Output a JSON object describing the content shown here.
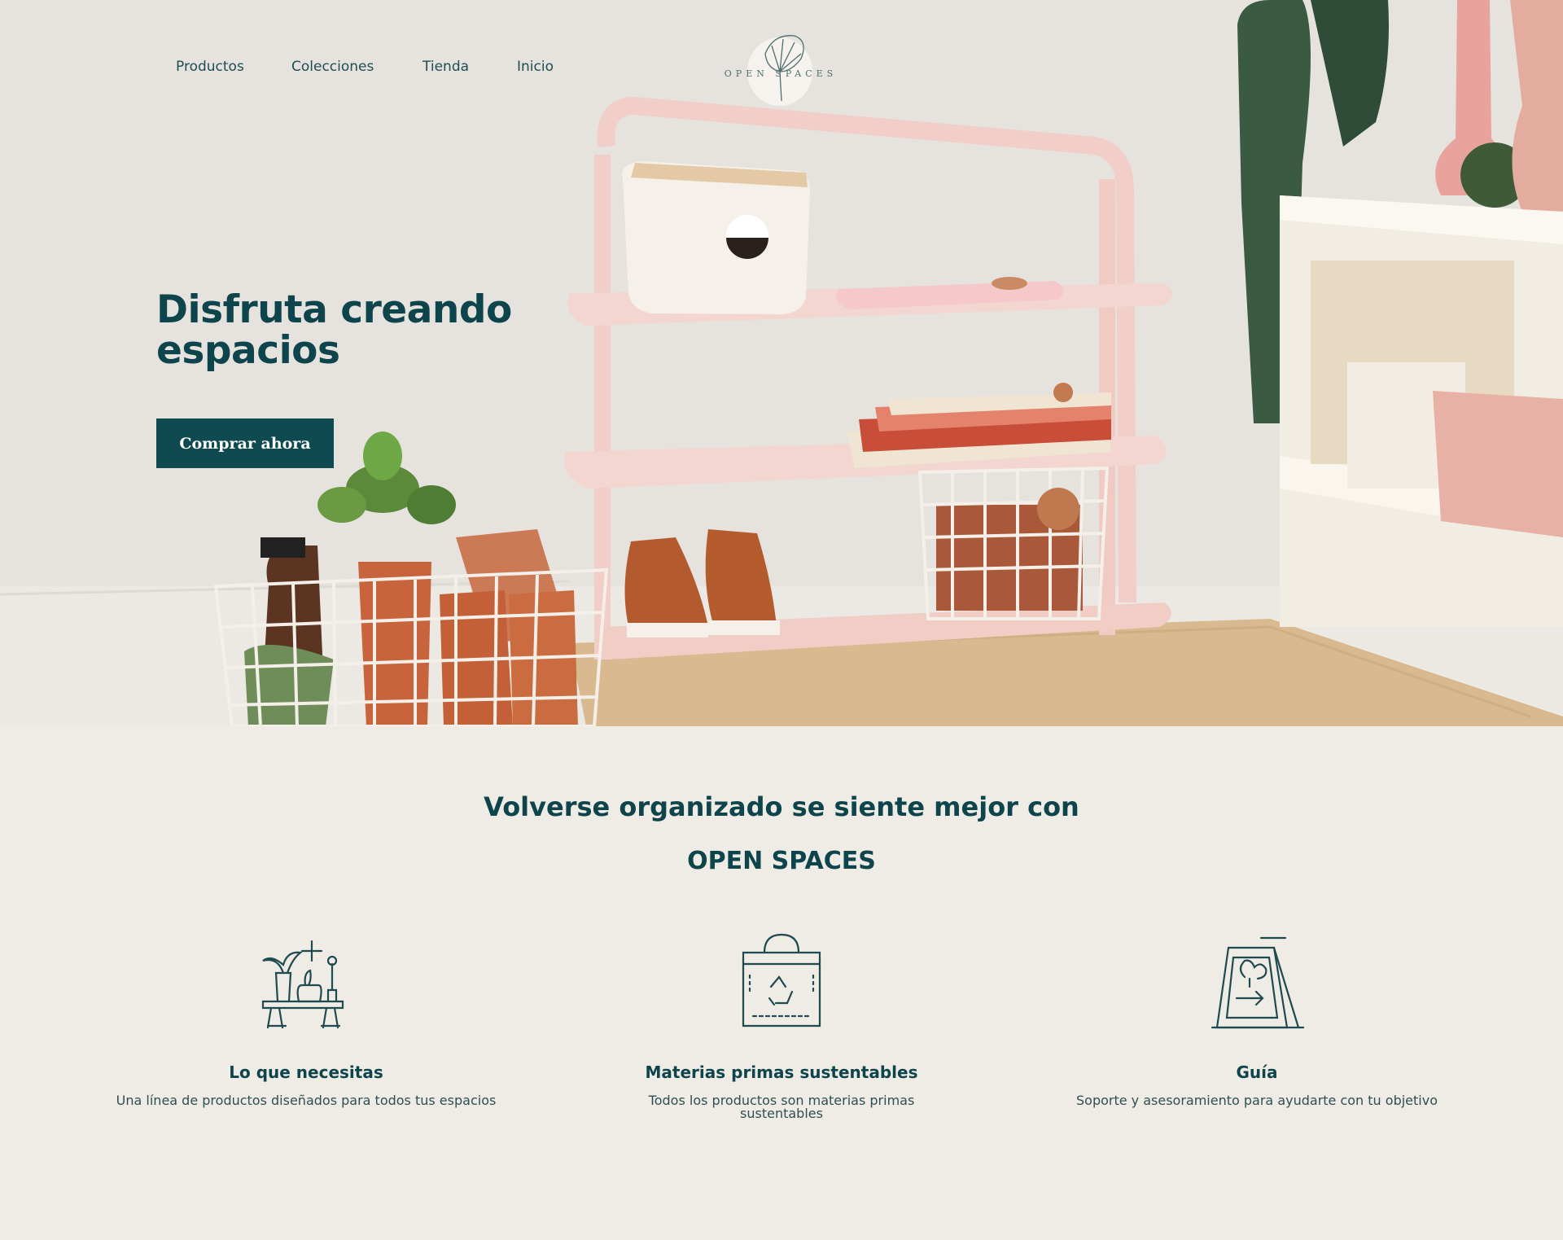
{
  "nav": {
    "items": [
      "Productos",
      "Colecciones",
      "Tienda",
      "Inicio"
    ]
  },
  "logo": {
    "text": "OPEN SPACES"
  },
  "hero": {
    "title": "Disfruta creando espacios",
    "cta_label": "Comprar ahora"
  },
  "section": {
    "headline": "Volverse organizado se siente mejor con",
    "brand": "OPEN SPACES"
  },
  "features": [
    {
      "icon": "plants-shelf-icon",
      "title": "Lo que necesitas",
      "text": "Una línea de productos diseñados para todos tus espacios"
    },
    {
      "icon": "recycle-bag-icon",
      "title": "Materias primas sustentables",
      "text": "Todos los productos son materias primas sustentables"
    },
    {
      "icon": "signboard-icon",
      "title": "Guía",
      "text": "Soporte y asesoramiento para ayudarte con tu objetivo"
    }
  ],
  "colors": {
    "primary": "#0f4a50",
    "background": "#efebe5",
    "shelf": "#f1cfc8",
    "terracotta": "#c8643c"
  }
}
